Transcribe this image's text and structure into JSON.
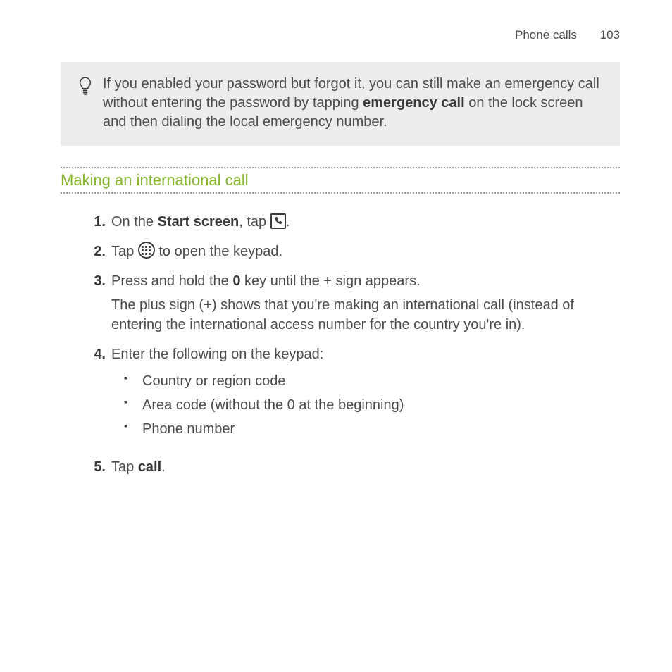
{
  "header": {
    "section": "Phone calls",
    "page_number": "103"
  },
  "tip": {
    "pre": "If you enabled your password but forgot it, you can still make an emergency call without entering the password by tapping ",
    "bold": "emergency call",
    "post": " on the lock screen and then dialing the local emergency number."
  },
  "section_title": "Making an international call",
  "steps": [
    {
      "n": "1.",
      "parts": [
        {
          "t": "text",
          "v": "On the "
        },
        {
          "t": "bold",
          "v": "Start screen"
        },
        {
          "t": "text",
          "v": ", tap "
        },
        {
          "t": "icon",
          "v": "phone-tile-icon"
        },
        {
          "t": "text",
          "v": "."
        }
      ]
    },
    {
      "n": "2.",
      "parts": [
        {
          "t": "text",
          "v": "Tap "
        },
        {
          "t": "icon",
          "v": "keypad-circle-icon"
        },
        {
          "t": "text",
          "v": " to open the keypad."
        }
      ]
    },
    {
      "n": "3.",
      "parts": [
        {
          "t": "text",
          "v": "Press and hold the "
        },
        {
          "t": "bold",
          "v": "0"
        },
        {
          "t": "text",
          "v": " key until the + sign appears."
        }
      ],
      "desc": "The plus sign (+) shows that you're making an international call (instead of entering the international access number for the country you're in)."
    },
    {
      "n": "4.",
      "parts": [
        {
          "t": "text",
          "v": "Enter the following on the keypad:"
        }
      ],
      "bullets": [
        "Country or region code",
        "Area code (without the 0 at the beginning)",
        "Phone number"
      ]
    },
    {
      "n": "5.",
      "parts": [
        {
          "t": "text",
          "v": "Tap "
        },
        {
          "t": "bold",
          "v": "call"
        },
        {
          "t": "text",
          "v": "."
        }
      ]
    }
  ]
}
